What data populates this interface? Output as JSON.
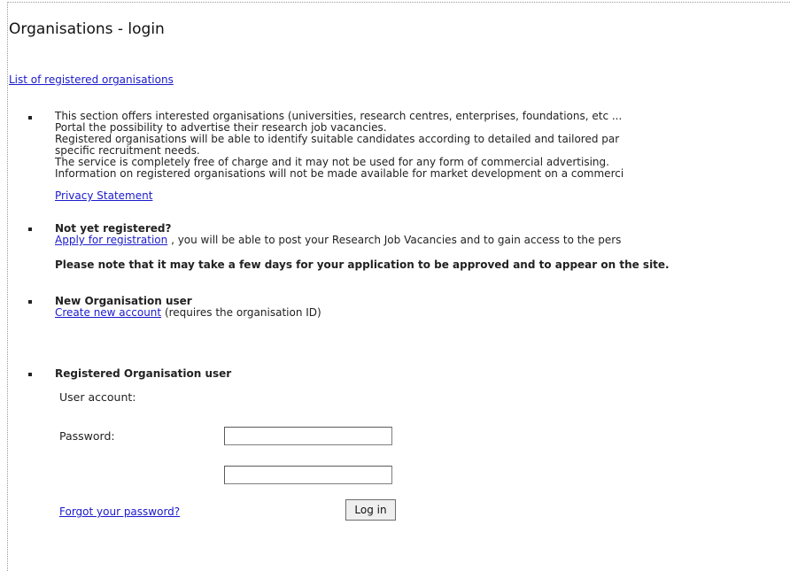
{
  "page": {
    "title": "Organisations - login",
    "list_link": "List of registered organisations"
  },
  "intro": {
    "lines": [
      "This section offers interested organisations (universities, research centres, enterprises, foundations, etc ...",
      "Portal the possibility to advertise their research job vacancies.",
      "Registered organisations will be able to identify suitable candidates according to detailed and tailored par",
      "specific recruitment needs.",
      "The service is completely free of charge and it may not be used for any form of commercial advertising.",
      "Information on registered organisations will not be made available for market development on a commerci"
    ],
    "privacy_link": "Privacy Statement"
  },
  "not_registered": {
    "heading": "Not yet registered?",
    "apply_link": "Apply for registration",
    "apply_rest": " , you will be able to post your Research Job Vacancies and to gain access to the pers",
    "note": "Please note that it may take a few days for your application to be approved and to appear on the site."
  },
  "new_user": {
    "heading": "New Organisation user",
    "create_link": "Create new account",
    "create_rest": " (requires the organisation ID)"
  },
  "registered_user": {
    "heading": "Registered Organisation user",
    "account_label": "User account:",
    "account_value": "",
    "password_label": "Password:",
    "password_value": "",
    "login_button": "Log in",
    "forgot_link": "Forgot your password?"
  }
}
